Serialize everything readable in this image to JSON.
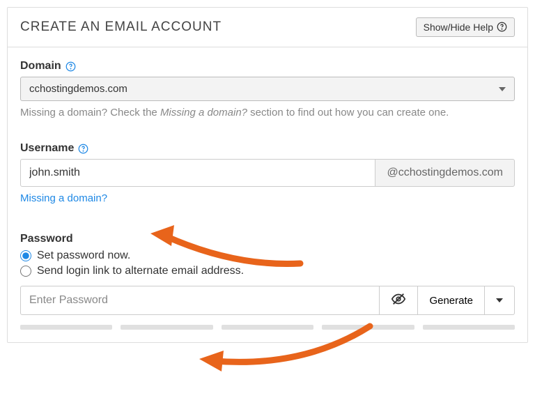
{
  "header": {
    "title": "CREATE AN EMAIL ACCOUNT",
    "help_button": "Show/Hide Help"
  },
  "domain": {
    "label": "Domain",
    "selected": "cchostingdemos.com",
    "hint_prefix": "Missing a domain? Check the ",
    "hint_em": "Missing a domain?",
    "hint_suffix": " section to find out how you can create one."
  },
  "username": {
    "label": "Username",
    "value": "john.smith",
    "suffix": "@cchostingdemos.com",
    "link": "Missing a domain?"
  },
  "password": {
    "label": "Password",
    "opt_now": "Set password now.",
    "opt_link": "Send login link to alternate email address.",
    "placeholder": "Enter Password",
    "generate": "Generate"
  }
}
